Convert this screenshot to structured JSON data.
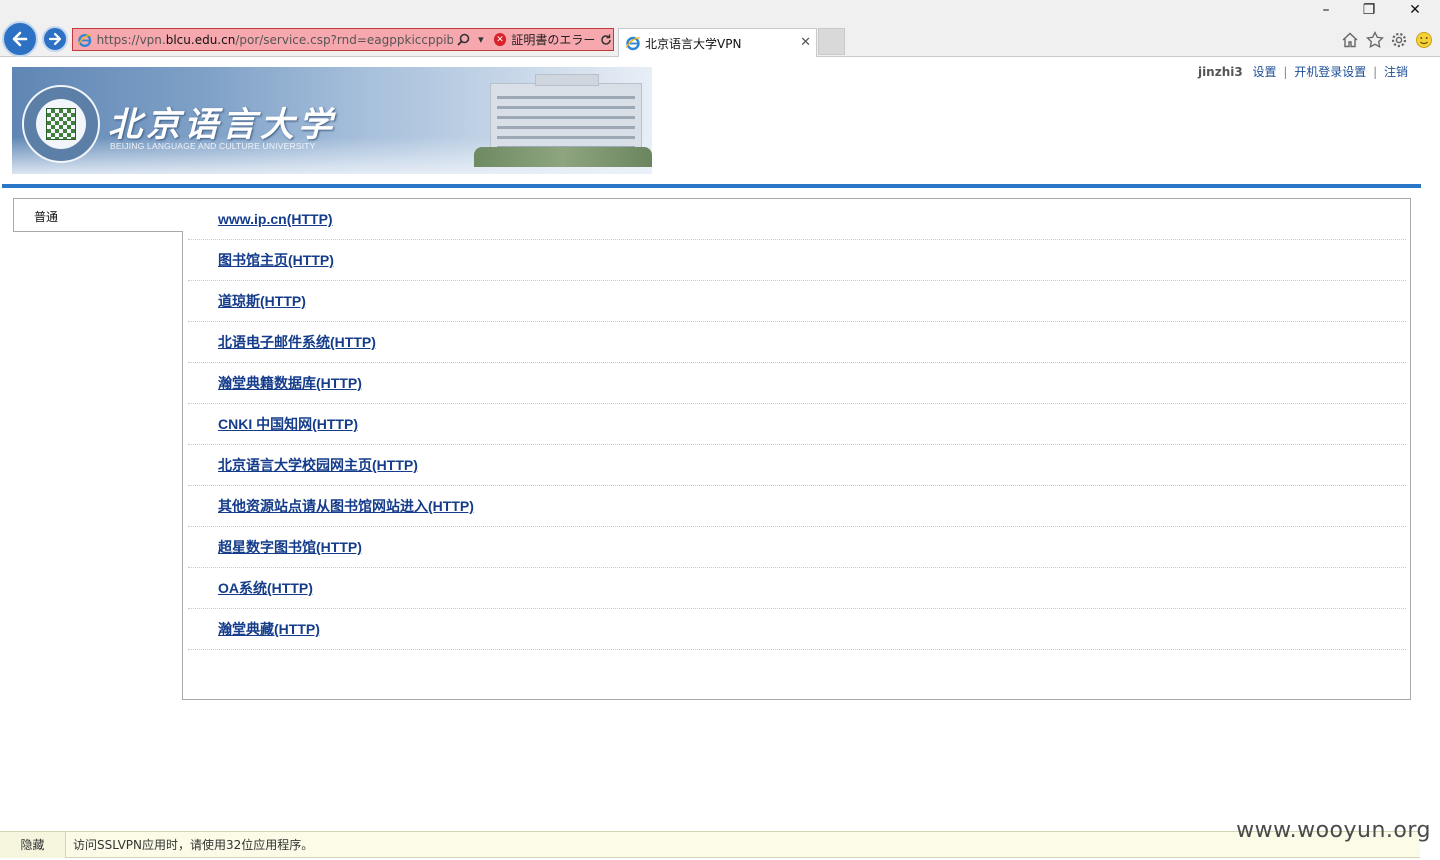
{
  "browser": {
    "url_prefix": "https://vpn.",
    "url_host": "blcu.edu.cn",
    "url_path": "/por/service.csp?rnd=eagppkiccppibona",
    "cert_error": "証明書のエラー",
    "tab_title": "北京语言大学VPN",
    "controls": {
      "minimize": "–",
      "restore": "❐",
      "close": "✕"
    }
  },
  "banner": {
    "logo_cn": "北京语言大学",
    "logo_en": "BEIJING LANGUAGE AND CULTURE UNIVERSITY"
  },
  "user": {
    "name": "jinzhi3",
    "links": [
      "设置",
      "开机登录设置",
      "注销"
    ]
  },
  "sidebar": {
    "tab_label": "普通"
  },
  "resources": [
    "www.ip.cn(HTTP)",
    "图书馆主页(HTTP)",
    "道琼斯(HTTP)",
    "北语电子邮件系统(HTTP)",
    "瀚堂典籍数据库(HTTP)",
    "CNKI 中国知网(HTTP)",
    "北京语言大学校园网主页(HTTP)",
    "其他资源站点请从图书馆网站进入(HTTP)",
    "超星数字图书馆(HTTP)",
    "OA系统(HTTP)",
    "瀚堂典藏(HTTP)"
  ],
  "status": {
    "hide_label": "隐藏",
    "message": "访问SSLVPN应用时，请使用32位应用程序。"
  },
  "watermark": "www.wooyun.org",
  "colors": {
    "accent_bar": "#2a77c8",
    "link": "#143c8a",
    "addr_error": "#f7a8ae"
  }
}
